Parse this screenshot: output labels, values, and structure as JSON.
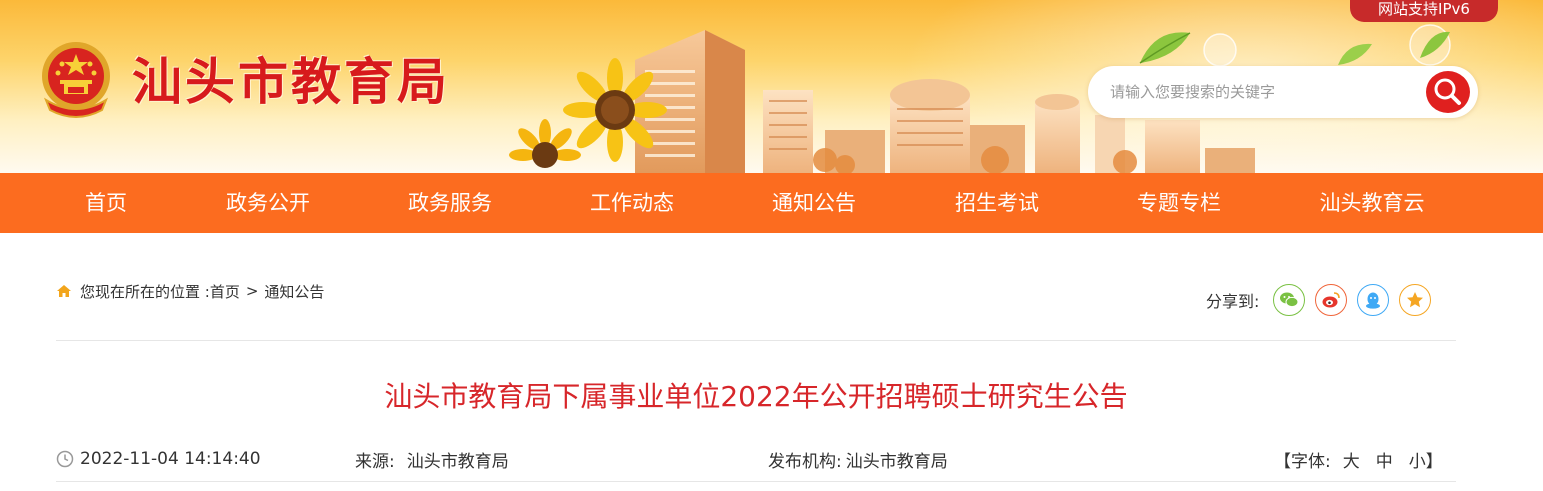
{
  "site": {
    "title": "汕头市教育局",
    "ipv6_badge": "网站支持IPv6",
    "search_placeholder": "请输入您要搜索的关键字"
  },
  "nav": {
    "items": [
      {
        "label": "首页"
      },
      {
        "label": "政务公开"
      },
      {
        "label": "政务服务"
      },
      {
        "label": "工作动态"
      },
      {
        "label": "通知公告"
      },
      {
        "label": "招生考试"
      },
      {
        "label": "专题专栏"
      },
      {
        "label": "汕头教育云"
      }
    ]
  },
  "breadcrumb": {
    "prefix": "您现在所在的位置 : ",
    "home": "首页",
    "separator": ">",
    "current": "通知公告"
  },
  "share": {
    "label": "分享到:",
    "icons": [
      "wechat-icon",
      "weibo-icon",
      "qq-icon",
      "favorite-icon"
    ]
  },
  "article": {
    "title": "汕头市教育局下属事业单位2022年公开招聘硕士研究生公告",
    "datetime": "2022-11-04 14:14:40",
    "source_label": "来源:",
    "source": "汕头市教育局",
    "publisher_label": "发布机构:",
    "publisher": "汕头市教育局",
    "font_open": "【字体:",
    "font_large": "大",
    "font_medium": "中",
    "font_small": "小",
    "font_close": "】"
  },
  "colors": {
    "nav_bg": "#fc6c1f",
    "title_red": "#d7262a",
    "brand_red": "#d71a1c"
  }
}
